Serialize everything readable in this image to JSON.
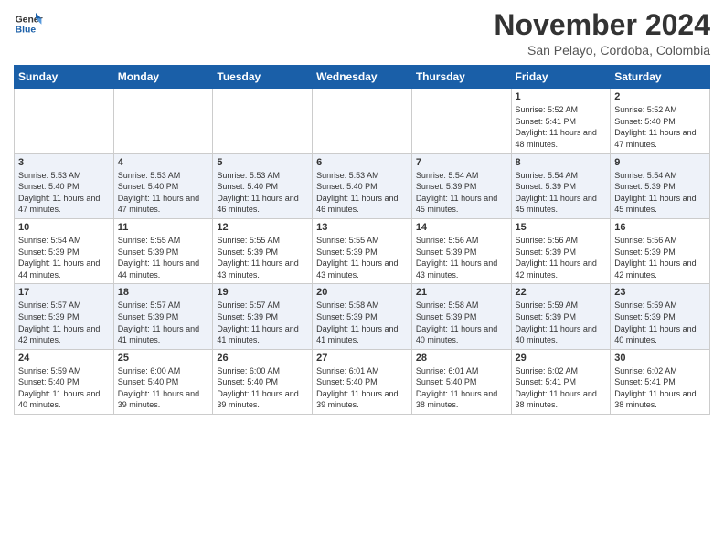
{
  "header": {
    "logo_line1": "General",
    "logo_line2": "Blue",
    "month": "November 2024",
    "location": "San Pelayo, Cordoba, Colombia"
  },
  "weekdays": [
    "Sunday",
    "Monday",
    "Tuesday",
    "Wednesday",
    "Thursday",
    "Friday",
    "Saturday"
  ],
  "weeks": [
    [
      {
        "day": "",
        "info": ""
      },
      {
        "day": "",
        "info": ""
      },
      {
        "day": "",
        "info": ""
      },
      {
        "day": "",
        "info": ""
      },
      {
        "day": "",
        "info": ""
      },
      {
        "day": "1",
        "info": "Sunrise: 5:52 AM\nSunset: 5:41 PM\nDaylight: 11 hours and 48 minutes."
      },
      {
        "day": "2",
        "info": "Sunrise: 5:52 AM\nSunset: 5:40 PM\nDaylight: 11 hours and 47 minutes."
      }
    ],
    [
      {
        "day": "3",
        "info": "Sunrise: 5:53 AM\nSunset: 5:40 PM\nDaylight: 11 hours and 47 minutes."
      },
      {
        "day": "4",
        "info": "Sunrise: 5:53 AM\nSunset: 5:40 PM\nDaylight: 11 hours and 47 minutes."
      },
      {
        "day": "5",
        "info": "Sunrise: 5:53 AM\nSunset: 5:40 PM\nDaylight: 11 hours and 46 minutes."
      },
      {
        "day": "6",
        "info": "Sunrise: 5:53 AM\nSunset: 5:40 PM\nDaylight: 11 hours and 46 minutes."
      },
      {
        "day": "7",
        "info": "Sunrise: 5:54 AM\nSunset: 5:39 PM\nDaylight: 11 hours and 45 minutes."
      },
      {
        "day": "8",
        "info": "Sunrise: 5:54 AM\nSunset: 5:39 PM\nDaylight: 11 hours and 45 minutes."
      },
      {
        "day": "9",
        "info": "Sunrise: 5:54 AM\nSunset: 5:39 PM\nDaylight: 11 hours and 45 minutes."
      }
    ],
    [
      {
        "day": "10",
        "info": "Sunrise: 5:54 AM\nSunset: 5:39 PM\nDaylight: 11 hours and 44 minutes."
      },
      {
        "day": "11",
        "info": "Sunrise: 5:55 AM\nSunset: 5:39 PM\nDaylight: 11 hours and 44 minutes."
      },
      {
        "day": "12",
        "info": "Sunrise: 5:55 AM\nSunset: 5:39 PM\nDaylight: 11 hours and 43 minutes."
      },
      {
        "day": "13",
        "info": "Sunrise: 5:55 AM\nSunset: 5:39 PM\nDaylight: 11 hours and 43 minutes."
      },
      {
        "day": "14",
        "info": "Sunrise: 5:56 AM\nSunset: 5:39 PM\nDaylight: 11 hours and 43 minutes."
      },
      {
        "day": "15",
        "info": "Sunrise: 5:56 AM\nSunset: 5:39 PM\nDaylight: 11 hours and 42 minutes."
      },
      {
        "day": "16",
        "info": "Sunrise: 5:56 AM\nSunset: 5:39 PM\nDaylight: 11 hours and 42 minutes."
      }
    ],
    [
      {
        "day": "17",
        "info": "Sunrise: 5:57 AM\nSunset: 5:39 PM\nDaylight: 11 hours and 42 minutes."
      },
      {
        "day": "18",
        "info": "Sunrise: 5:57 AM\nSunset: 5:39 PM\nDaylight: 11 hours and 41 minutes."
      },
      {
        "day": "19",
        "info": "Sunrise: 5:57 AM\nSunset: 5:39 PM\nDaylight: 11 hours and 41 minutes."
      },
      {
        "day": "20",
        "info": "Sunrise: 5:58 AM\nSunset: 5:39 PM\nDaylight: 11 hours and 41 minutes."
      },
      {
        "day": "21",
        "info": "Sunrise: 5:58 AM\nSunset: 5:39 PM\nDaylight: 11 hours and 40 minutes."
      },
      {
        "day": "22",
        "info": "Sunrise: 5:59 AM\nSunset: 5:39 PM\nDaylight: 11 hours and 40 minutes."
      },
      {
        "day": "23",
        "info": "Sunrise: 5:59 AM\nSunset: 5:39 PM\nDaylight: 11 hours and 40 minutes."
      }
    ],
    [
      {
        "day": "24",
        "info": "Sunrise: 5:59 AM\nSunset: 5:40 PM\nDaylight: 11 hours and 40 minutes."
      },
      {
        "day": "25",
        "info": "Sunrise: 6:00 AM\nSunset: 5:40 PM\nDaylight: 11 hours and 39 minutes."
      },
      {
        "day": "26",
        "info": "Sunrise: 6:00 AM\nSunset: 5:40 PM\nDaylight: 11 hours and 39 minutes."
      },
      {
        "day": "27",
        "info": "Sunrise: 6:01 AM\nSunset: 5:40 PM\nDaylight: 11 hours and 39 minutes."
      },
      {
        "day": "28",
        "info": "Sunrise: 6:01 AM\nSunset: 5:40 PM\nDaylight: 11 hours and 38 minutes."
      },
      {
        "day": "29",
        "info": "Sunrise: 6:02 AM\nSunset: 5:41 PM\nDaylight: 11 hours and 38 minutes."
      },
      {
        "day": "30",
        "info": "Sunrise: 6:02 AM\nSunset: 5:41 PM\nDaylight: 11 hours and 38 minutes."
      }
    ]
  ]
}
